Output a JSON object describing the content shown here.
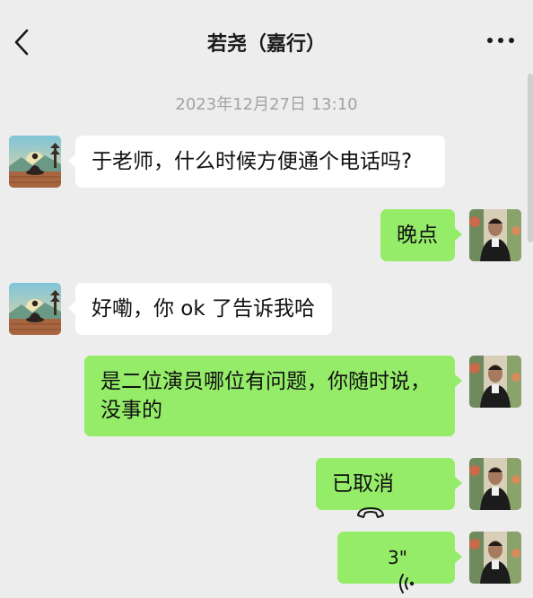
{
  "header": {
    "title": "若尧（嘉行）"
  },
  "timestamp": "2023年12月27日 13:10",
  "messages": [
    {
      "side": "left",
      "text": "于老师，什么时候方便通个电话吗?"
    },
    {
      "side": "right",
      "text": "晚点"
    },
    {
      "side": "left",
      "text": "好嘞，你 ok 了告诉我哈"
    },
    {
      "side": "right",
      "line1": "是二位演员哪位有问题，你随时说，",
      "line2": "没事的"
    },
    {
      "side": "right",
      "text": "已取消",
      "type": "call-cancelled"
    },
    {
      "side": "right",
      "text": "3\"",
      "type": "voice"
    }
  ],
  "colors": {
    "background": "#ededed",
    "bubble_self": "#95ec69",
    "bubble_other": "#ffffff",
    "timestamp": "#a3a3a3"
  },
  "icons": {
    "back": "chevron-left-icon",
    "more": "more-dots-icon",
    "call": "phone-hangup-icon",
    "voice": "voice-wave-icon"
  }
}
